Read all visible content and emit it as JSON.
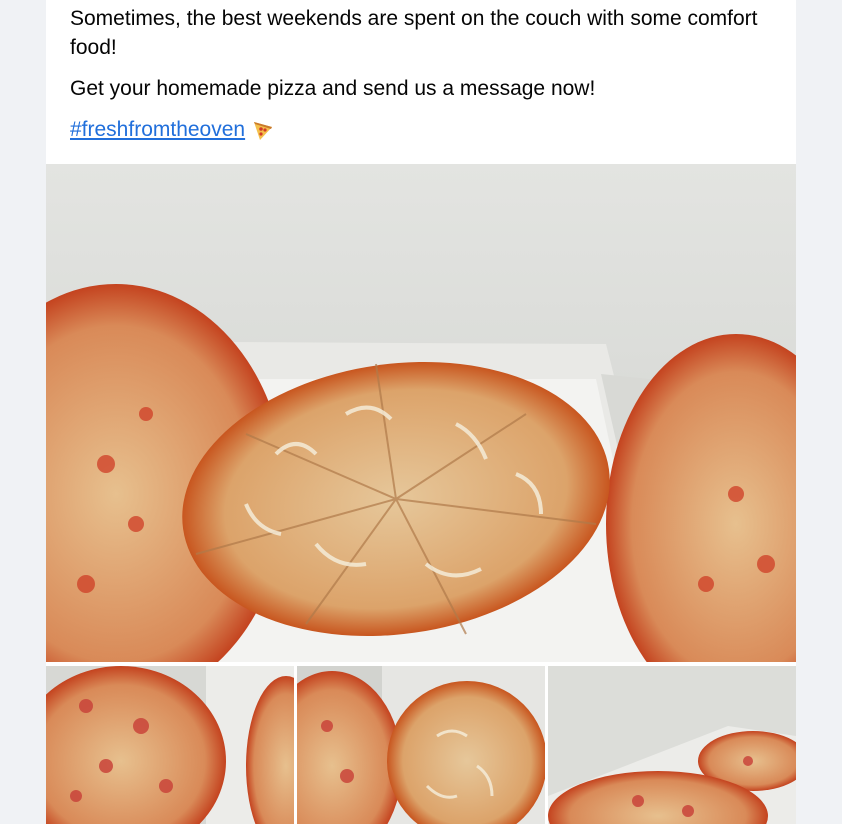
{
  "post": {
    "paragraphs": [
      "Sometimes, the best weekends are spent on the couch with some comfort food!",
      "Get your homemade pizza and send us a message now!"
    ],
    "hashtag": "#freshfromtheoven",
    "hashtag_emoji": "pizza-icon"
  },
  "photos": {
    "main": {
      "alt": "pizza-photo"
    },
    "thumbnails": [
      {
        "alt": "pizza-photo"
      },
      {
        "alt": "pizza-photo"
      },
      {
        "alt": "pizza-photo"
      }
    ]
  },
  "colors": {
    "link": "#216fdb",
    "text": "#050505",
    "page_bg": "#f0f2f5"
  }
}
